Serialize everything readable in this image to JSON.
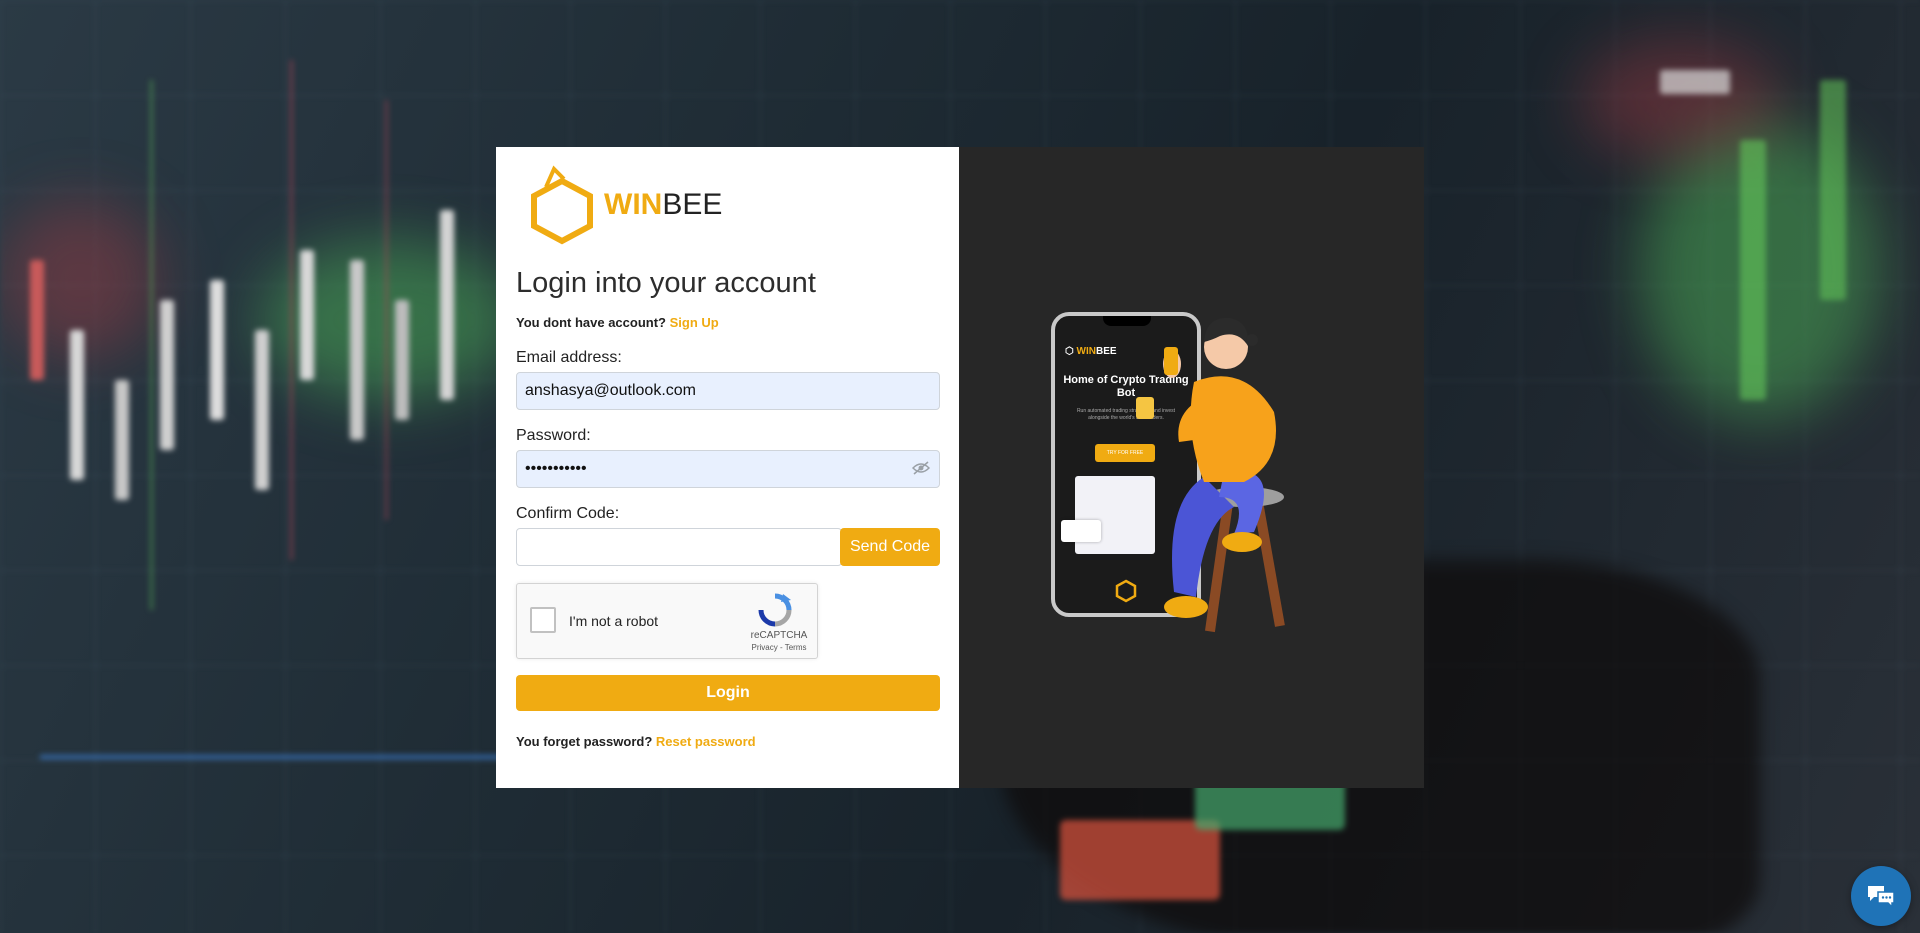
{
  "brand": {
    "win": "WIN",
    "bee": "BEE",
    "accent": "#f0ab12"
  },
  "login": {
    "heading": "Login into your account",
    "no_account_text": "You dont have account?",
    "signup_link": "Sign Up",
    "email_label": "Email address:",
    "email_value": "anshasya@outlook.com",
    "password_label": "Password:",
    "password_value": "•••••••••••",
    "code_label": "Confirm Code:",
    "code_value": "",
    "send_code_label": "Send Code",
    "login_label": "Login",
    "forgot_text": "You forget password?",
    "reset_link": "Reset password"
  },
  "recaptcha": {
    "label": "I'm not a robot",
    "brand": "reCAPTCHA",
    "terms": "Privacy - Terms",
    "checked": false
  },
  "illustration": {
    "phone_brand_win": "WIN",
    "phone_brand_bee": "BEE",
    "phone_title": "Home of Crypto Trading Bot",
    "phone_subtitle": "Run automated trading strategies and invest alongside the world's best traders.",
    "phone_cta": "TRY FOR FREE"
  },
  "chat": {
    "icon": "chat-bubbles-icon",
    "color": "#1f73b7"
  }
}
